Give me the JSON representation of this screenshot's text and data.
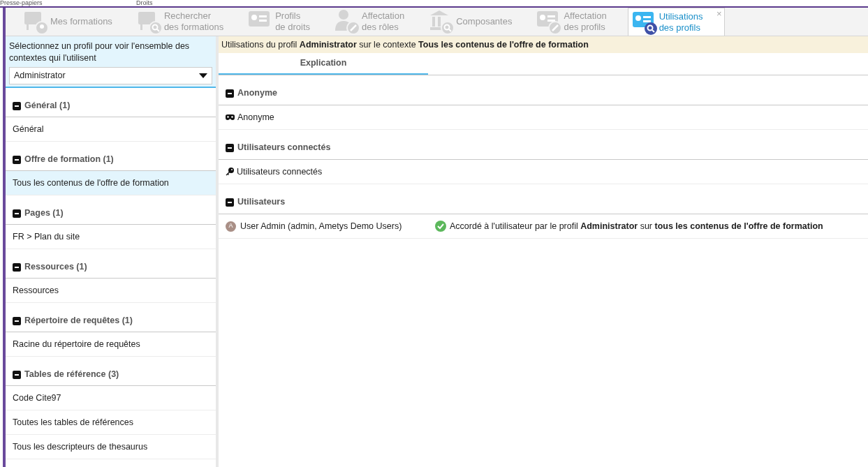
{
  "ribbon_groups": [
    "Presse-papiers",
    "Droits"
  ],
  "tabs": [
    {
      "label": [
        "Mes formations"
      ],
      "selected": false
    },
    {
      "label": [
        "Rechercher",
        "des formations"
      ],
      "selected": false
    },
    {
      "label": [
        "Profils",
        "de droits"
      ],
      "selected": false
    },
    {
      "label": [
        "Affectation",
        "des rôles"
      ],
      "selected": false
    },
    {
      "label": [
        "Composantes"
      ],
      "selected": false
    },
    {
      "label": [
        "Affectation",
        "des profils"
      ],
      "selected": false
    },
    {
      "label": [
        "Utilisations",
        "des profils"
      ],
      "selected": true,
      "close": "×"
    }
  ],
  "left_panel": {
    "instruction": "Sélectionnez un profil pour voir l'ensemble des contextes qui l'utilisent",
    "profile_select": {
      "value": "Administrator"
    },
    "groups": [
      {
        "title": "Général (1)",
        "expanded": true,
        "items": [
          {
            "label": "Général",
            "selected": false
          }
        ]
      },
      {
        "title": "Offre de formation (1)",
        "expanded": true,
        "items": [
          {
            "label": "Tous les contenus de l'offre de formation",
            "selected": true
          }
        ]
      },
      {
        "title": "Pages (1)",
        "expanded": true,
        "items": [
          {
            "label": "FR > Plan du site",
            "selected": false
          }
        ]
      },
      {
        "title": "Ressources (1)",
        "expanded": true,
        "items": [
          {
            "label": "Ressources",
            "selected": false
          }
        ]
      },
      {
        "title": "Répertoire de requêtes (1)",
        "expanded": true,
        "items": [
          {
            "label": "Racine du répertoire de requêtes",
            "selected": false
          }
        ]
      },
      {
        "title": "Tables de référence (3)",
        "expanded": true,
        "items": [
          {
            "label": "Code Cite97",
            "selected": false
          },
          {
            "label": "Toutes les tables de références",
            "selected": false
          },
          {
            "label": "Tous les descripteurs de thesaurus",
            "selected": false
          }
        ]
      }
    ]
  },
  "right_panel": {
    "context_bar": "Utilisations du profil **Administrator** sur le contexte **Tous les contenus de l'offre de formation**",
    "tabs": [
      {
        "label": "Explication",
        "selected": true
      }
    ],
    "groups": [
      {
        "title": "Anonyme",
        "expanded": true,
        "rows": [
          {
            "kind": "anonymous",
            "label": "Anonyme"
          }
        ]
      },
      {
        "title": "Utilisateurs connectés",
        "expanded": true,
        "rows": [
          {
            "kind": "connected",
            "label": "Utilisateurs connectés"
          }
        ]
      },
      {
        "title": "Utilisateurs",
        "expanded": true,
        "rows": [
          {
            "kind": "user",
            "avatar": "A",
            "label": "User Admin (admin, Ametys Demo Users)",
            "granted": true,
            "explanation": "Accordé à l'utilisateur par le profil **Administrator** sur **tous les contenus de l'offre de formation**"
          }
        ]
      }
    ]
  }
}
